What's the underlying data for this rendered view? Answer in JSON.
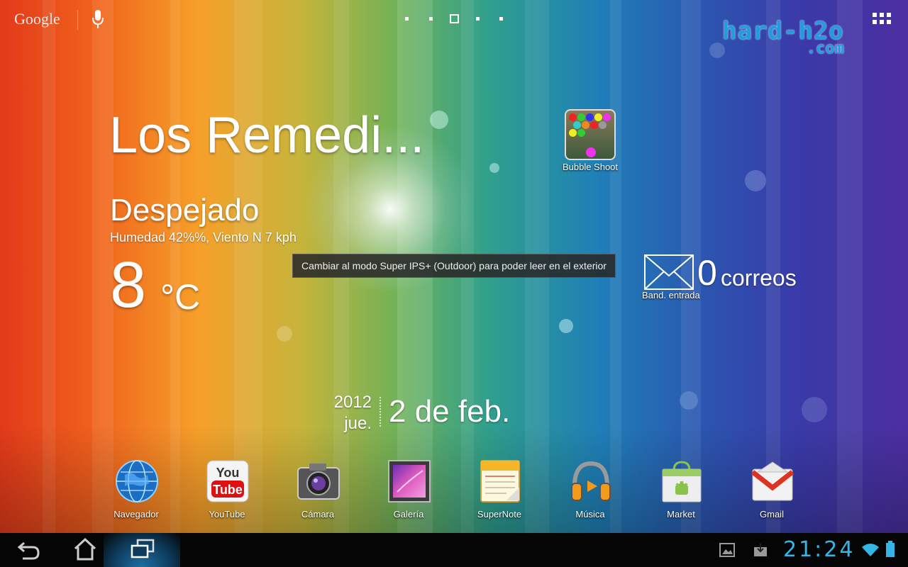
{
  "topbar": {
    "search_label": "Google",
    "page_indicator": {
      "count": 5,
      "active_index": 2
    },
    "apps_icon": "all-apps-grid-icon",
    "voice_icon": "microphone-icon"
  },
  "watermark": {
    "line1": "hard-h2o",
    "line2": ".com",
    "color": "#1f9de0"
  },
  "weather": {
    "city": "Los Remedi...",
    "condition": "Despejado",
    "details": "Humedad 42%%, Viento N 7 kph",
    "temperature": "8",
    "unit": "°C"
  },
  "tooltip": {
    "text": "Cambiar al modo Super IPS+ (Outdoor) para poder leer en el exterior"
  },
  "shortcut": {
    "label": "Bubble Shoot",
    "icon": "bubble-shoot-app-icon"
  },
  "mail_widget": {
    "count": "0",
    "word": "correos",
    "inbox_label": "Band. entrada",
    "icon": "envelope-icon"
  },
  "date_widget": {
    "year": "2012",
    "weekday": "jue.",
    "date": "2 de feb."
  },
  "dock": {
    "items": [
      {
        "label": "Navegador",
        "icon": "browser-globe-icon"
      },
      {
        "label": "YouTube",
        "icon": "youtube-icon"
      },
      {
        "label": "Cámara",
        "icon": "camera-icon"
      },
      {
        "label": "Galería",
        "icon": "gallery-icon"
      },
      {
        "label": "SuperNote",
        "icon": "supernote-icon"
      },
      {
        "label": "Música",
        "icon": "headphones-icon"
      },
      {
        "label": "Market",
        "icon": "market-bag-icon"
      },
      {
        "label": "Gmail",
        "icon": "gmail-icon"
      }
    ]
  },
  "navbar": {
    "back_icon": "back-icon",
    "home_icon": "home-icon",
    "recents_icon": "recent-apps-icon",
    "time": "21:24",
    "accent": "#33b5e5",
    "status_icons": [
      "screenshot-icon",
      "download-icon",
      "wifi-icon",
      "battery-icon"
    ]
  }
}
